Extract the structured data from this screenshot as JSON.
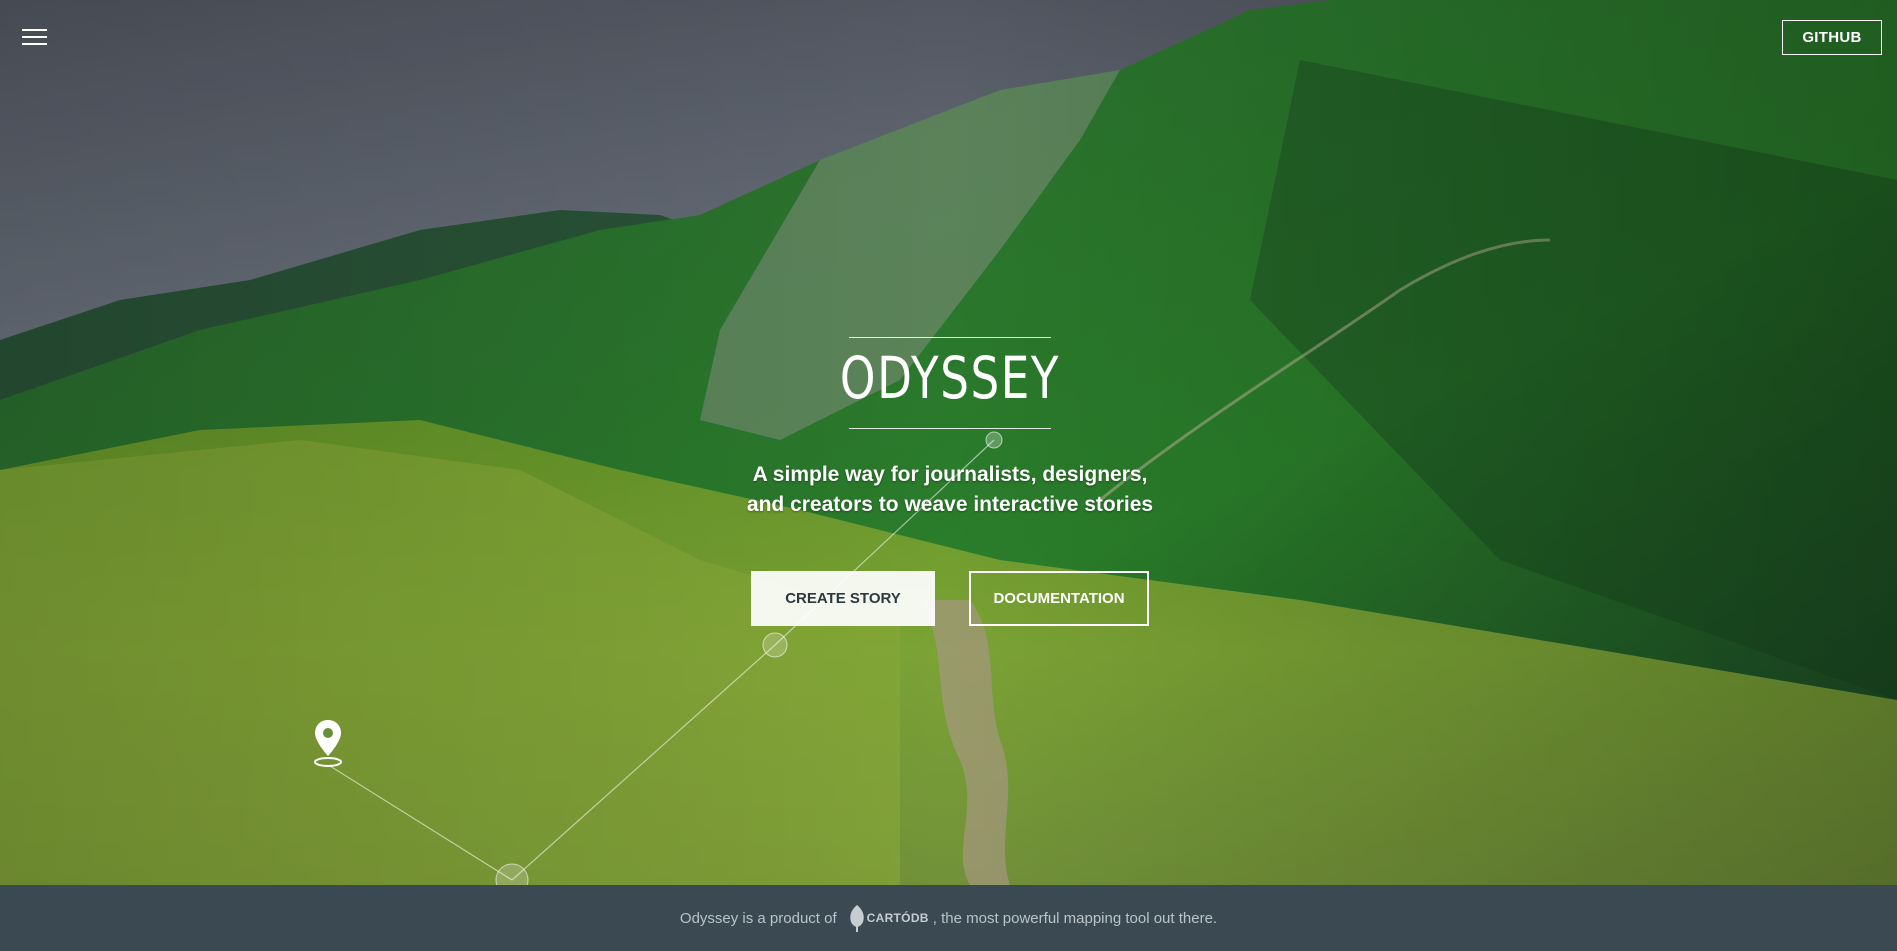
{
  "header": {
    "menu_icon": "hamburger-menu-icon",
    "github_label": "GITHUB"
  },
  "hero": {
    "title": "ODYSSEY",
    "subtitle_line1": "A simple way for journalists, designers,",
    "subtitle_line2": "and creators to weave interactive stories",
    "create_story_label": "CREATE STORY",
    "documentation_label": "DOCUMENTATION",
    "pin_icon": "map-pin-icon"
  },
  "footer": {
    "text_before": "Odyssey is a product of",
    "brand": "CARTÓDB",
    "text_after": ", the most powerful mapping tool out there."
  },
  "colors": {
    "footer_bg": "#3b4a52",
    "button_fill": "#ffffff",
    "text_dark": "#2c3a40"
  }
}
